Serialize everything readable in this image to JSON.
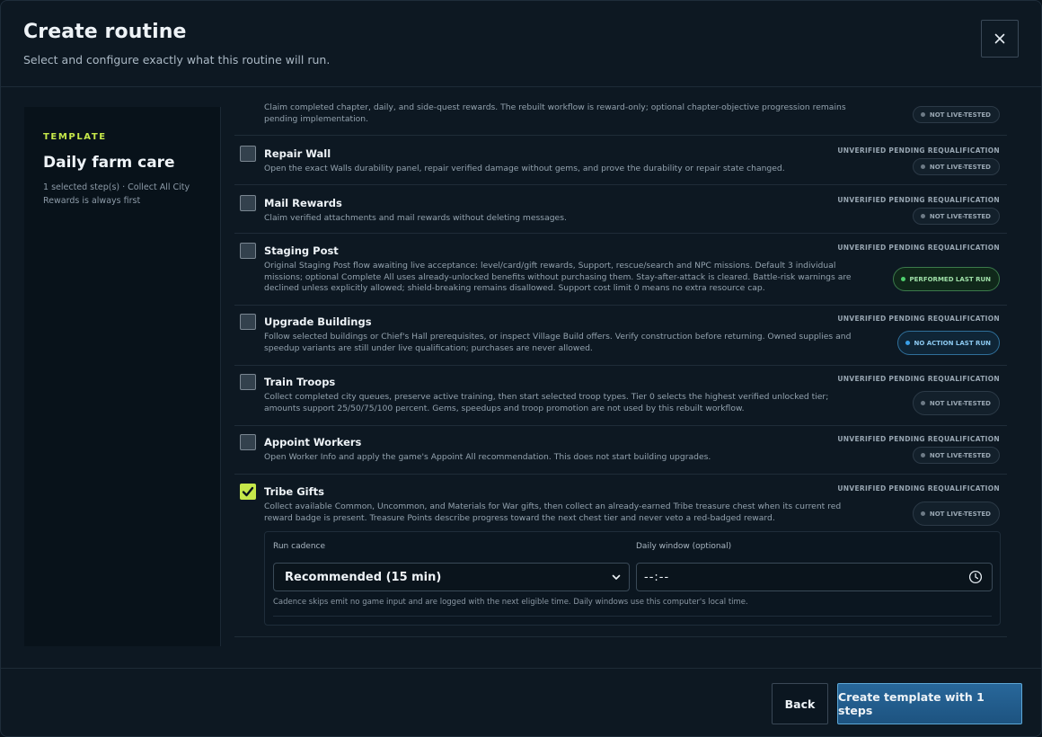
{
  "dialog": {
    "title": "Create routine",
    "subtitle": "Select and configure exactly what this routine will run.",
    "close_icon": "close-icon"
  },
  "sidebar": {
    "eyebrow": "TEMPLATE",
    "name": "Daily farm care",
    "meta": "1 selected step(s) · Collect All City Rewards is always first"
  },
  "steps": [
    {
      "name": "",
      "desc": "Claim completed chapter, daily, and side-quest rewards. The rebuilt workflow is reward-only; optional chapter-objective progression remains pending implementation.",
      "status": "",
      "pill": "NOT LIVE-TESTED",
      "checked": false
    },
    {
      "name": "Repair Wall",
      "desc": "Open the exact Walls durability panel, repair verified damage without gems, and prove the durability or repair state changed.",
      "status": "UNVERIFIED PENDING REQUALIFICATION",
      "pill": "NOT LIVE-TESTED",
      "checked": false
    },
    {
      "name": "Mail Rewards",
      "desc": "Claim verified attachments and mail rewards without deleting messages.",
      "status": "UNVERIFIED PENDING REQUALIFICATION",
      "pill": "NOT LIVE-TESTED",
      "checked": false
    },
    {
      "name": "Staging Post",
      "desc": "Original Staging Post flow awaiting live acceptance: level/card/gift rewards, Support, rescue/search and NPC missions. Default 3 individual missions; optional Complete All uses already-unlocked benefits without purchasing them. Stay-after-attack is cleared. Battle-risk warnings are declined unless explicitly allowed; shield-breaking remains disallowed. Support cost limit 0 means no extra resource cap.",
      "status": "UNVERIFIED PENDING REQUALIFICATION",
      "pill": "PERFORMED LAST RUN",
      "checked": false
    },
    {
      "name": "Upgrade Buildings",
      "desc": "Follow selected buildings or Chief's Hall prerequisites, or inspect Village Build offers. Verify construction before returning. Owned supplies and speedup variants are still under live qualification; purchases are never allowed.",
      "status": "UNVERIFIED PENDING REQUALIFICATION",
      "pill": "NO ACTION LAST RUN",
      "checked": false
    },
    {
      "name": "Train Troops",
      "desc": "Collect completed city queues, preserve active training, then start selected troop types. Tier 0 selects the highest verified unlocked tier; amounts support 25/50/75/100 percent. Gems, speedups and troop promotion are not used by this rebuilt workflow.",
      "status": "UNVERIFIED PENDING REQUALIFICATION",
      "pill": "NOT LIVE-TESTED",
      "checked": false
    },
    {
      "name": "Appoint Workers",
      "desc": "Open Worker Info and apply the game's Appoint All recommendation. This does not start building upgrades.",
      "status": "UNVERIFIED PENDING REQUALIFICATION",
      "pill": "NOT LIVE-TESTED",
      "checked": false
    },
    {
      "name": "Tribe Gifts",
      "desc": "Collect available Common, Uncommon, and Materials for War gifts, then collect an already-earned Tribe treasure chest when its current red reward badge is present. Treasure Points describe progress toward the next chest tier and never veto a red-badged reward.",
      "status": "UNVERIFIED PENDING REQUALIFICATION",
      "pill": "NOT LIVE-TESTED",
      "checked": true
    }
  ],
  "cadence": {
    "run_label": "Run cadence",
    "run_value": "Recommended (15 min)",
    "window_label": "Daily window (optional)",
    "window_value": "--:--",
    "note": "Cadence skips emit no game input and are logged with the next eligible time. Daily windows use this computer's local time."
  },
  "footer": {
    "back_label": "Back",
    "create_label": "Create template with 1 steps"
  }
}
